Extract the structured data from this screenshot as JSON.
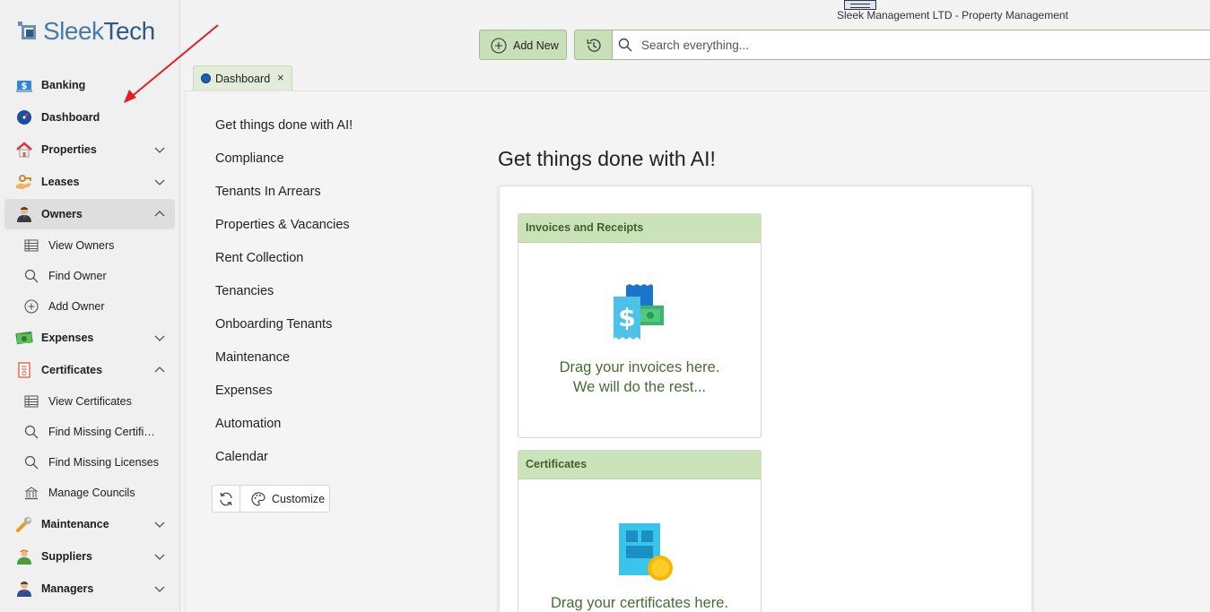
{
  "app": {
    "logo_text_light": "Sleek",
    "logo_text_dark": "Tech",
    "window_title": "Sleek Management LTD - Property Management",
    "accent_color": "#c8e0b8",
    "accent_border": "#9fbd89"
  },
  "sidebar": {
    "items": [
      {
        "label": "Banking",
        "icon": "bank-icon"
      },
      {
        "label": "Dashboard",
        "icon": "dashboard-icon"
      },
      {
        "label": "Properties",
        "icon": "house-icon"
      },
      {
        "label": "Leases",
        "icon": "hand-key-icon"
      },
      {
        "label": "Owners",
        "icon": "owner-person-icon",
        "expanded": true
      },
      {
        "label": "Expenses",
        "icon": "money-icon"
      },
      {
        "label": "Certificates",
        "icon": "certificate-icon",
        "expanded": true
      },
      {
        "label": "Maintenance",
        "icon": "wrench-icon"
      },
      {
        "label": "Suppliers",
        "icon": "supplier-person-icon"
      },
      {
        "label": "Managers",
        "icon": "manager-person-icon"
      }
    ],
    "owners_sub": [
      {
        "label": "View Owners",
        "icon": "table-icon"
      },
      {
        "label": "Find Owner",
        "icon": "search-icon"
      },
      {
        "label": "Add Owner",
        "icon": "add-circle-icon"
      }
    ],
    "certificates_sub": [
      {
        "label": "View Certificates",
        "icon": "table-icon"
      },
      {
        "label": "Find Missing Certificates",
        "icon": "search-icon"
      },
      {
        "label": "Find Missing Licenses",
        "icon": "search-icon"
      },
      {
        "label": "Manage Councils",
        "icon": "building-icon"
      }
    ]
  },
  "toolbar": {
    "add_new_label": "Add New",
    "search_placeholder": "Search everything..."
  },
  "tabs": [
    {
      "label": "Dashboard",
      "close": "×"
    }
  ],
  "dashboard": {
    "menu": [
      "Get things done with AI!",
      "Compliance",
      "Tenants In Arrears",
      "Properties & Vacancies",
      "Rent Collection",
      "Tenancies",
      "Onboarding Tenants",
      "Maintenance",
      "Expenses",
      "Automation",
      "Calendar"
    ],
    "customize_label": "Customize",
    "page_title": "Get things done with AI!",
    "cards": [
      {
        "title": "Invoices and Receipts",
        "line1": "Drag your invoices here.",
        "line2": "We will do the rest..."
      },
      {
        "title": "Certificates",
        "line1": "Drag your certificates here.",
        "line2": ""
      }
    ]
  }
}
